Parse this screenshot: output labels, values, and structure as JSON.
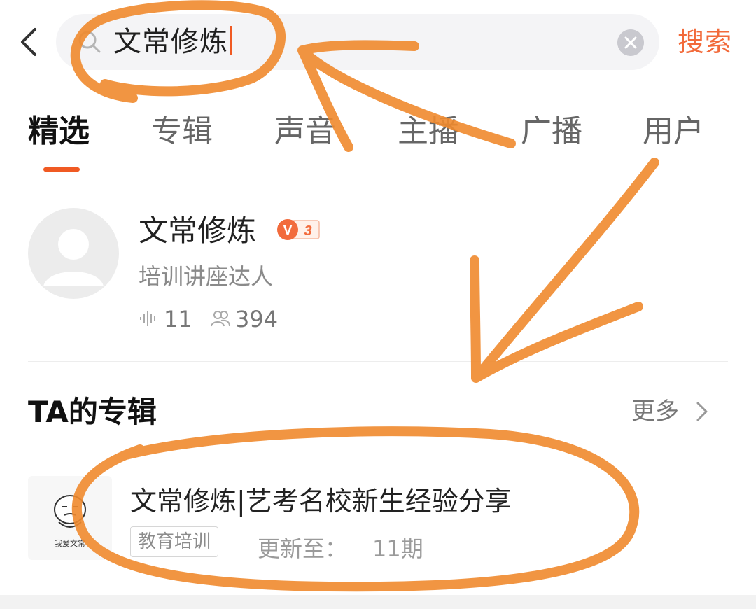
{
  "search": {
    "query": "文常修炼",
    "button_label": "搜索"
  },
  "tabs": [
    {
      "label": "精选",
      "active": true
    },
    {
      "label": "专辑",
      "active": false
    },
    {
      "label": "声音",
      "active": false
    },
    {
      "label": "主播",
      "active": false
    },
    {
      "label": "广播",
      "active": false
    },
    {
      "label": "用户",
      "active": false
    }
  ],
  "user": {
    "name": "文常修炼",
    "vip_level": "3",
    "tag": "培训讲座达人",
    "tracks_count": "11",
    "followers_count": "394"
  },
  "albums_section": {
    "title": "TA的专辑",
    "more_label": "更多"
  },
  "album": {
    "cover_text": "我爱文常",
    "title": "文常修炼|艺考名校新生经验分享",
    "category": "教育培训",
    "update_label": "更新至：",
    "update_count": "11期"
  },
  "colors": {
    "accent": "#f05a23",
    "search_button": "#f26a3a",
    "annotation": "#f08a2e"
  },
  "icons": [
    "back-arrow-icon",
    "search-icon",
    "clear-icon",
    "vip-badge-icon",
    "audio-wave-icon",
    "users-icon",
    "chevron-right-icon"
  ]
}
